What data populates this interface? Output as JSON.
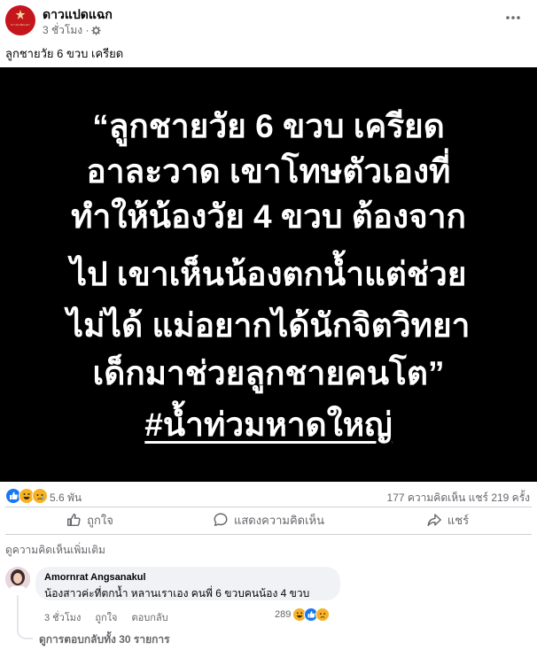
{
  "post": {
    "page_name": "ดาวแปดแฉก",
    "time": "3 ชั่วโมง ·",
    "privacy_icon": "globe-gear-icon",
    "caption": "ลูกชายวัย 6 ขวบ เครียด",
    "avatar_logo_text": "ดาวแปดแฉก",
    "image_lines": [
      "“ลูกชายวัย 6 ขวบ เครียด",
      "อาละวาด เขาโทษตัวเองที่",
      "ทำให้น้องวัย 4 ขวบ ต้องจาก",
      "ไป เขาเห็นน้องตกน้ำแต่ช่วย",
      "ไม่ได้ แม่อยากได้นักจิตวิทยา",
      "เด็กมาช่วยลูกชายคนโต”"
    ],
    "image_hashtag": "#น้ำท่วมหาดใหญ่"
  },
  "stats": {
    "reaction_count": "5.6 พัน",
    "comments_shares": "177 ความคิดเห็น  แชร์ 219 ครั้ง",
    "reaction_colors": [
      "#1877f2",
      "#f7b125",
      "#f7b125"
    ]
  },
  "actions": {
    "like": "ถูกใจ",
    "comment": "แสดงความคิดเห็น",
    "share": "แชร์"
  },
  "comments": {
    "more_label": "ดูความคิดเห็นเพิ่มเติม",
    "commenter_name": "Amornrat Angsanakul",
    "comment_text": "น้องสาวค่ะที่ตกน้ำ หลานเราเอง คนพี่ 6 ขวบคนน้อง 4 ขวบ",
    "time": "3 ชั่วโมง",
    "like": "ถูกใจ",
    "reply": "ตอบกลับ",
    "reaction_count": "289",
    "view_replies": "ดูการตอบกลับทั้ง 30 รายการ"
  }
}
